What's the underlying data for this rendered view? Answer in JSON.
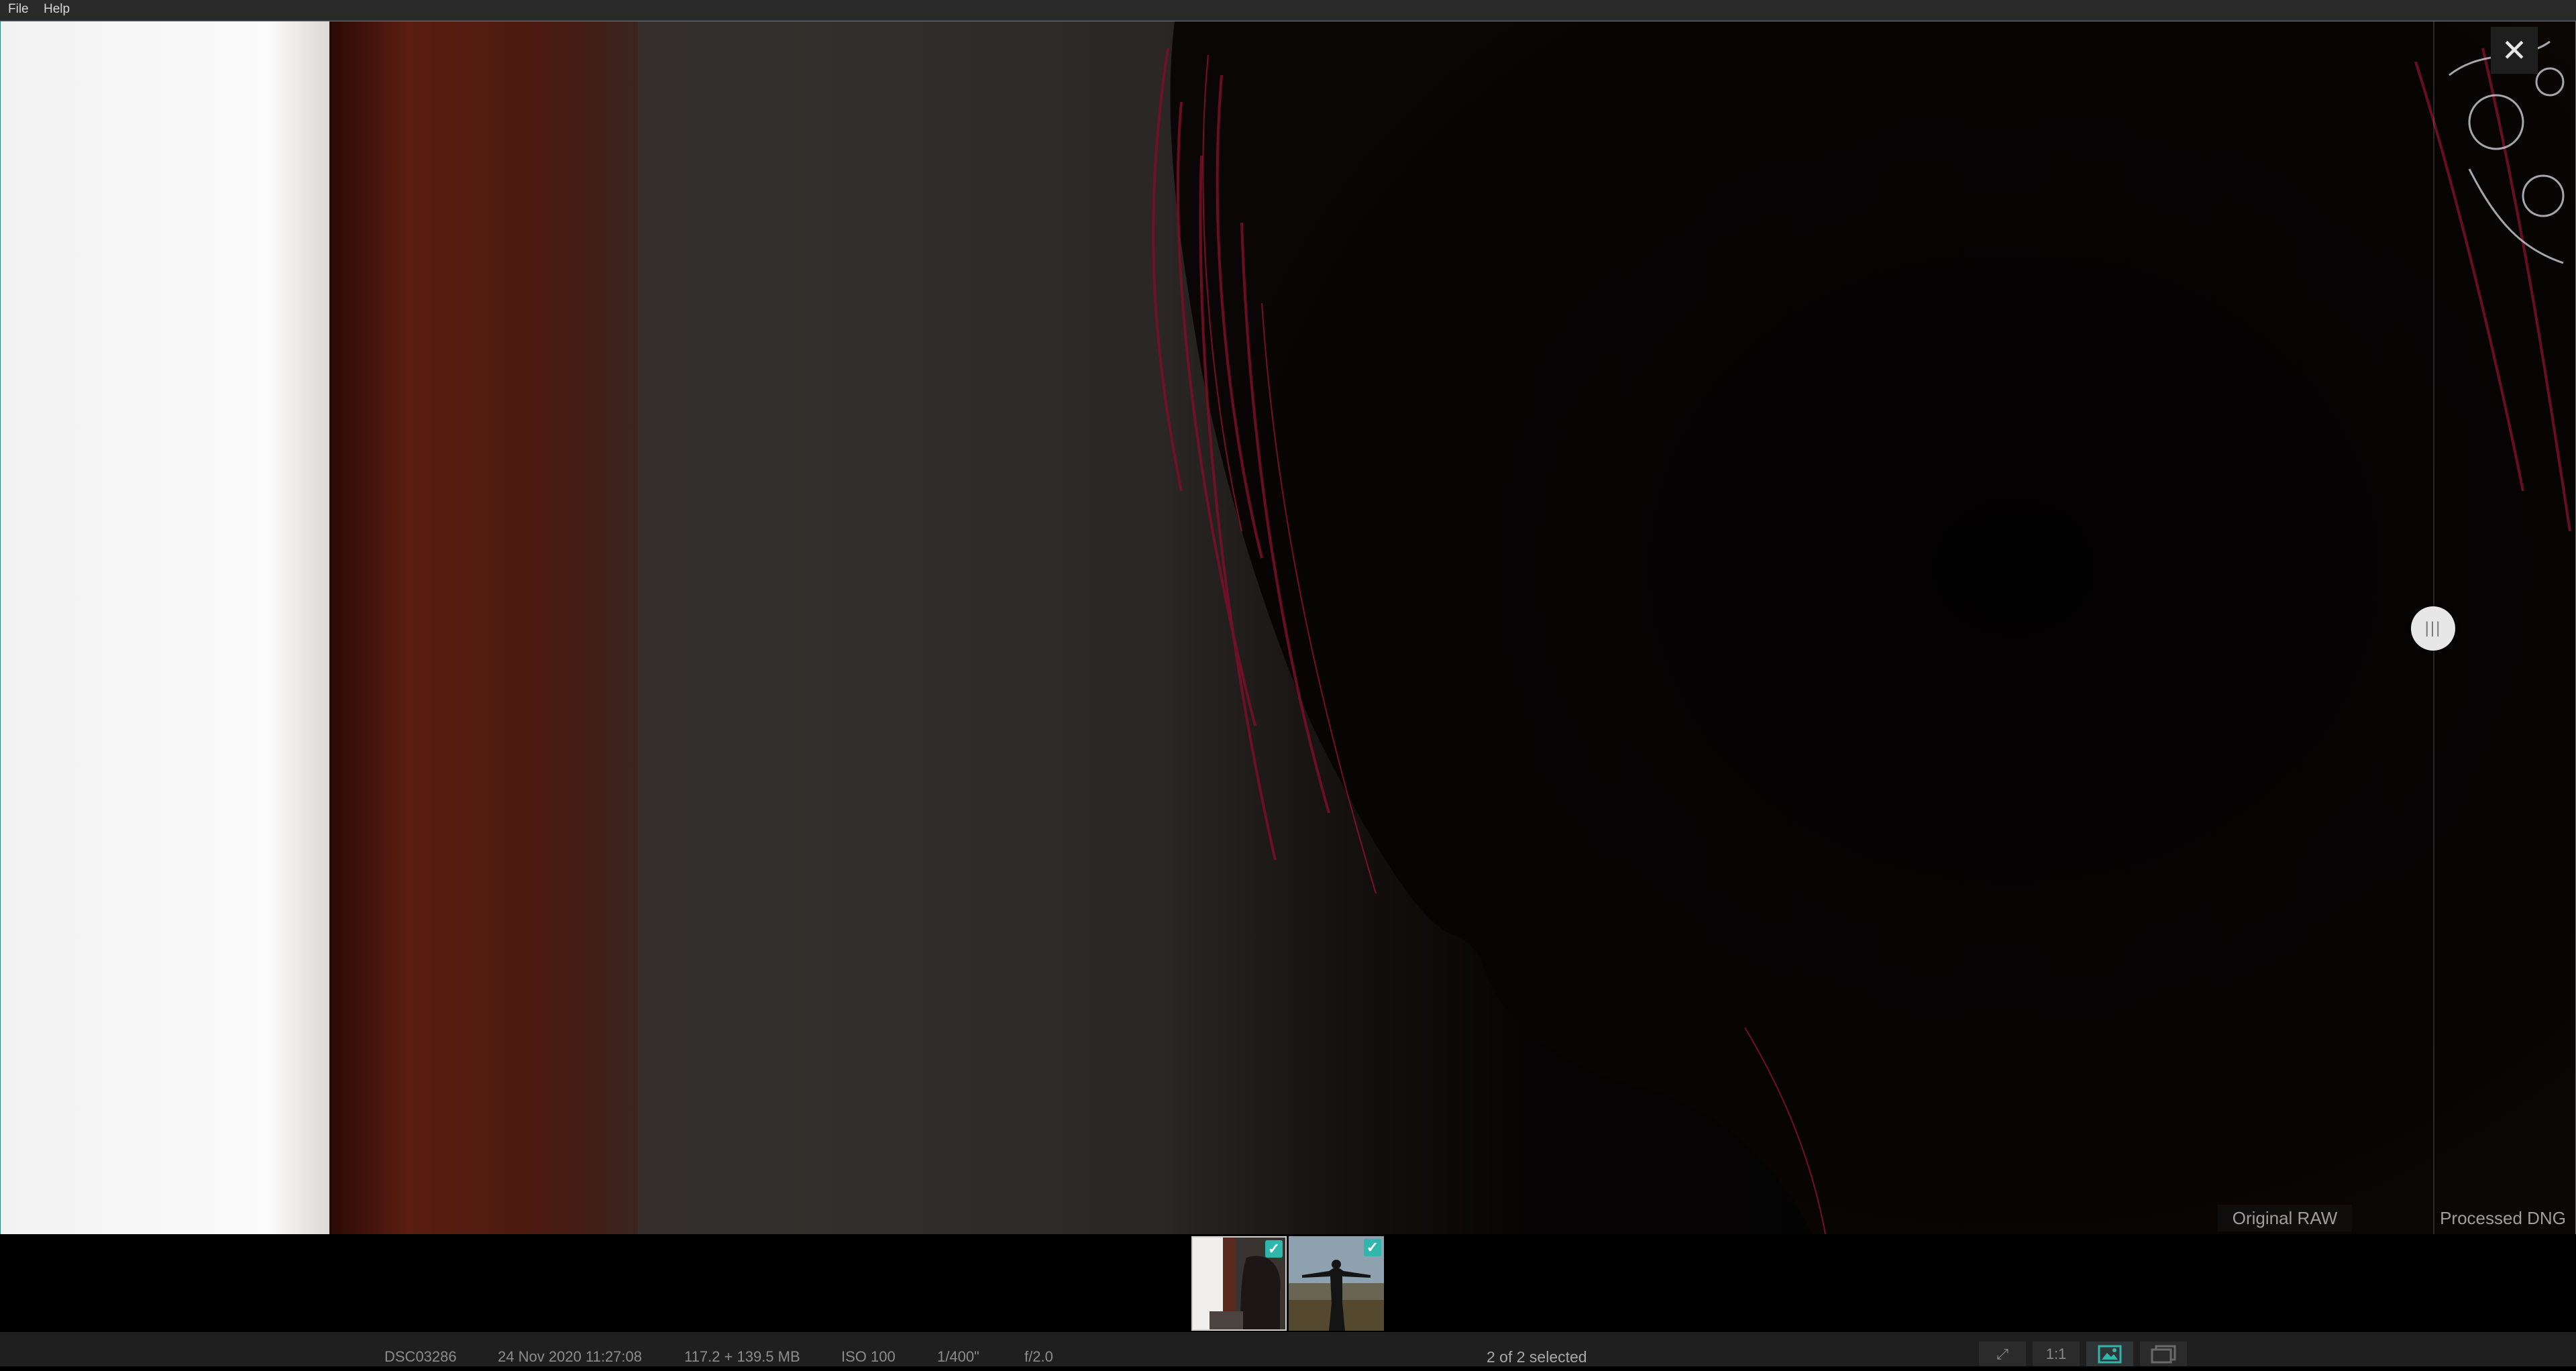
{
  "menu": {
    "file": "File",
    "help": "Help"
  },
  "viewer": {
    "close_icon": "close-icon",
    "compare_labels": {
      "original": "Original RAW",
      "processed": "Processed DNG"
    }
  },
  "filmstrip": {
    "thumbnails": [
      {
        "selected": true,
        "checked": true
      },
      {
        "selected": false,
        "checked": true
      }
    ]
  },
  "status": {
    "filename": "DSC03286",
    "datetime": "24 Nov 2020 11:27:08",
    "sizes": "117.2 + 139.5 MB",
    "iso": "ISO 100",
    "shutter": "1/400\"",
    "aperture": "f/2.0",
    "selection": "2 of 2 selected"
  },
  "tools": {
    "fit": "⤢",
    "one_to_one": "1:1",
    "single_view": "single-view-icon",
    "compare_view": "compare-view-icon"
  },
  "colors": {
    "accent": "#2fb7ad",
    "border": "#2c8d86"
  }
}
